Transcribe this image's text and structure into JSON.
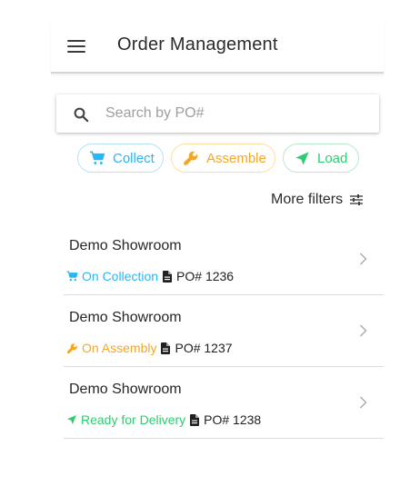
{
  "header": {
    "menu_icon": "hamburger-menu-icon",
    "title": "Order Management"
  },
  "search": {
    "placeholder": "Search by PO#",
    "value": "",
    "icon": "search-icon"
  },
  "filters": {
    "chips": [
      {
        "label": "Collect",
        "icon": "cart-icon",
        "color": "#29b6f6"
      },
      {
        "label": "Assemble",
        "icon": "wrench-icon",
        "color": "#f5a623"
      },
      {
        "label": "Load",
        "icon": "navigation-arrow-icon",
        "color": "#2ecc71"
      }
    ],
    "more_label": "More filters",
    "more_icon": "tune-icon"
  },
  "orders": [
    {
      "title": "Demo Showroom",
      "status": "On Collection",
      "status_color": "#29b6f6",
      "status_icon": "cart-icon",
      "po": "PO# 1236"
    },
    {
      "title": "Demo Showroom",
      "status": "On Assembly",
      "status_color": "#f5a623",
      "status_icon": "wrench-icon",
      "po": "PO# 1237"
    },
    {
      "title": "Demo Showroom",
      "status": "Ready for Delivery",
      "status_color": "#2ecc71",
      "status_icon": "navigation-arrow-icon",
      "po": "PO# 1238"
    }
  ]
}
